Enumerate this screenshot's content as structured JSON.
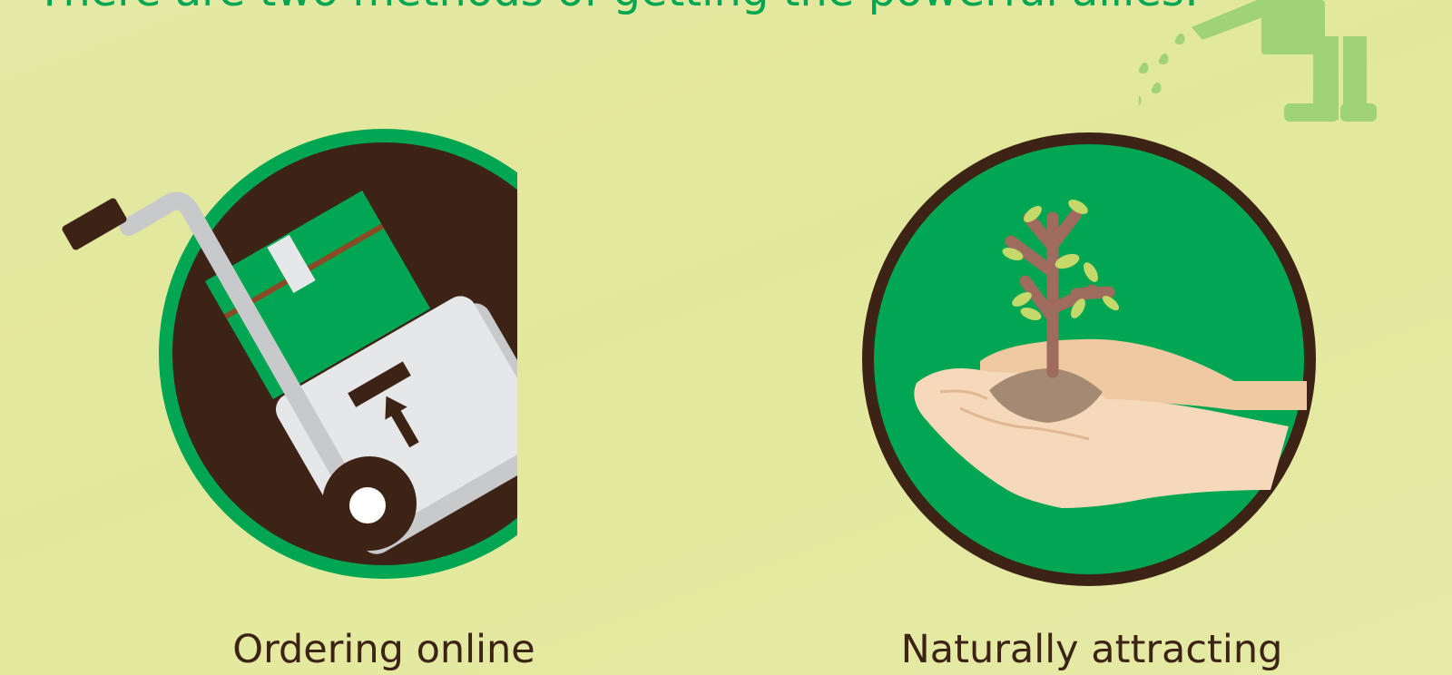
{
  "header": {
    "headline": "There are two methods of getting the powerful allies:"
  },
  "methods": [
    {
      "label": "Ordering online",
      "icon": "hand-truck-with-boxes-icon"
    },
    {
      "label": "Naturally attracting",
      "icon": "hands-holding-sapling-icon"
    }
  ],
  "colors": {
    "background": "#e3e99f",
    "brand_green": "#00a651",
    "dark_brown": "#3d2216",
    "decor_green": "#a0d27a"
  }
}
